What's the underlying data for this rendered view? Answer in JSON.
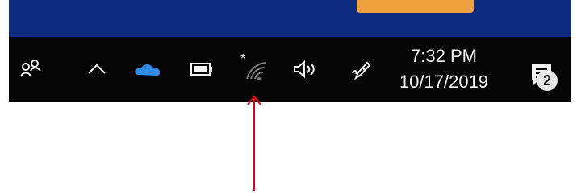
{
  "theme": {
    "window_color": "#0f2b80",
    "orange_button_color": "#f0a23f",
    "taskbar_color": "#050505",
    "cloud_color": "#2f8be6",
    "arrow_color": "#e2001a"
  },
  "tray": {
    "icons": [
      "people-icon",
      "chevron-up-icon",
      "onedrive-cloud-icon",
      "battery-icon",
      "wifi-icon",
      "volume-icon",
      "pen-icon",
      "notifications-icon"
    ],
    "clock": {
      "time": "7:32 PM",
      "date": "10/17/2019"
    },
    "notifications": {
      "count": "2"
    }
  }
}
